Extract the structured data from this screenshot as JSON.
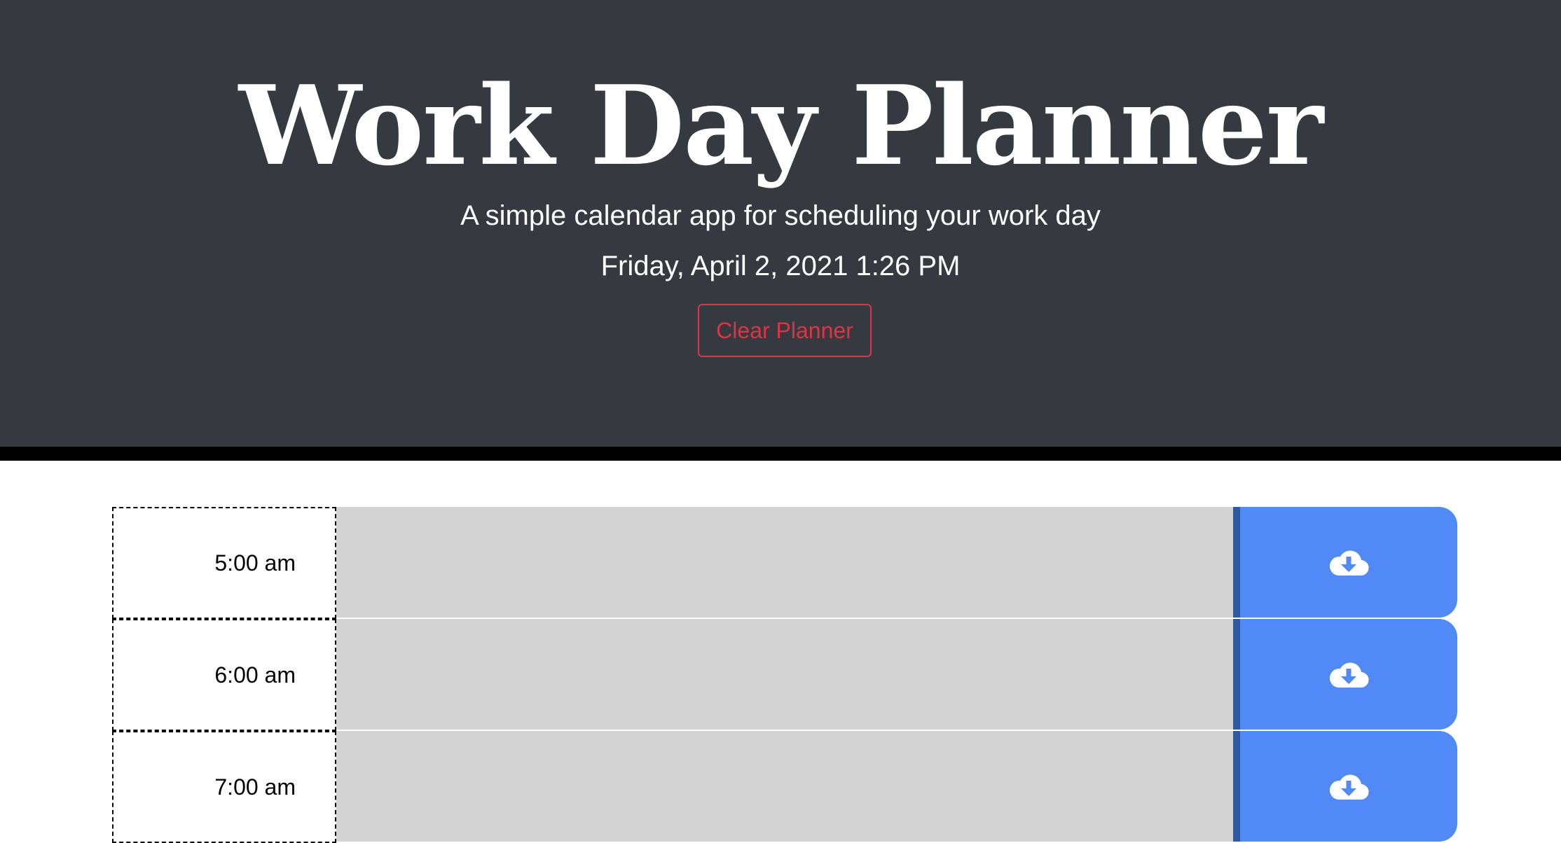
{
  "header": {
    "title": "Work Day Planner",
    "subtitle": "A simple calendar app for scheduling your work day",
    "current_date": "Friday, April 2, 2021 1:26 PM",
    "clear_button_label": "Clear Planner"
  },
  "colors": {
    "header_background": "#343a40",
    "clear_button": "#dc3545",
    "task_past": "#d3d3d3",
    "save_button": "#4f8af6"
  },
  "rows": [
    {
      "hour": "5:00 am",
      "task": "",
      "save_icon": "cloud-download-icon"
    },
    {
      "hour": "6:00 am",
      "task": "",
      "save_icon": "cloud-download-icon"
    },
    {
      "hour": "7:00 am",
      "task": "",
      "save_icon": "cloud-download-icon"
    }
  ]
}
